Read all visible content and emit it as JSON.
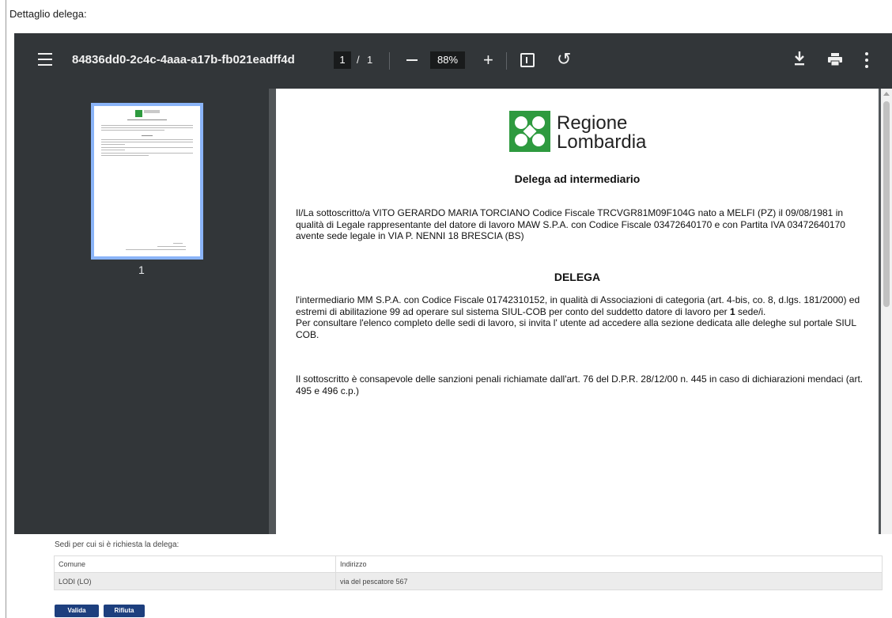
{
  "page": {
    "heading": "Dettaglio delega:"
  },
  "viewer": {
    "toolbar": {
      "doc_title": "84836dd0-2c4c-4aaa-a17b-fb021eadff4d",
      "current_page": "1",
      "page_separator": "/",
      "total_pages": "1",
      "zoom": "88%",
      "zoom_minus_label": "−",
      "zoom_plus_label": "+",
      "rotate_icon": "↺"
    },
    "sidebar": {
      "thumbnail_label": "1"
    },
    "document": {
      "logo_line1": "Regione",
      "logo_line2": "Lombardia",
      "title": "Delega ad intermediario",
      "intro": "Il/La sottoscritto/a VITO GERARDO MARIA TORCIANO Codice Fiscale TRCVGR81M09F104G nato a MELFI (PZ) il 09/08/1981 in qualità di Legale rappresentante del datore di lavoro MAW S.P.A. con Codice Fiscale 03472640170 e con Partita IVA 03472640170 avente sede legale in VIA P. NENNI 18 BRESCIA (BS)",
      "section_title": "DELEGA",
      "delega_text": "l'intermediario MM S.P.A. con Codice Fiscale 01742310152,  in qualità di Associazioni di categoria (art. 4-bis, co. 8, d.lgs. 181/2000) ed estremi di abilitazione 99 ad operare sul sistema SIUL-COB per conto del suddetto datore di lavoro per",
      "sedi_count": "1",
      "sedi_suffix": "sede/i.",
      "consult_text": "Per consultare  l'elenco completo delle sedi di lavoro, si invita l' utente ad accedere alla sezione dedicata alle deleghe sul portale SIUL COB.",
      "declaration_text": "Il sottoscritto è consapevole delle sanzioni penali richiamate dall'art. 76 del D.P.R. 28/12/00 n. 445 in caso di dichiarazioni mendaci (art. 495 e 496 c.p.)"
    }
  },
  "sedi": {
    "label": "Sedi per cui si è richiesta la delega:",
    "columns": [
      "Comune",
      "Indirizzo"
    ],
    "rows": [
      {
        "comune": "LODI (LO)",
        "indirizzo": "via del pescatore 567"
      }
    ]
  },
  "actions": {
    "validate_label": "Valida",
    "reject_label": "Rifiuta"
  },
  "colors": {
    "toolbar_bg": "#323639",
    "viewer_bg": "#525659",
    "thumbnail_border": "#8ab4f8",
    "button_bg": "#1d3f7e",
    "logo_green": "#2e9a3f"
  }
}
